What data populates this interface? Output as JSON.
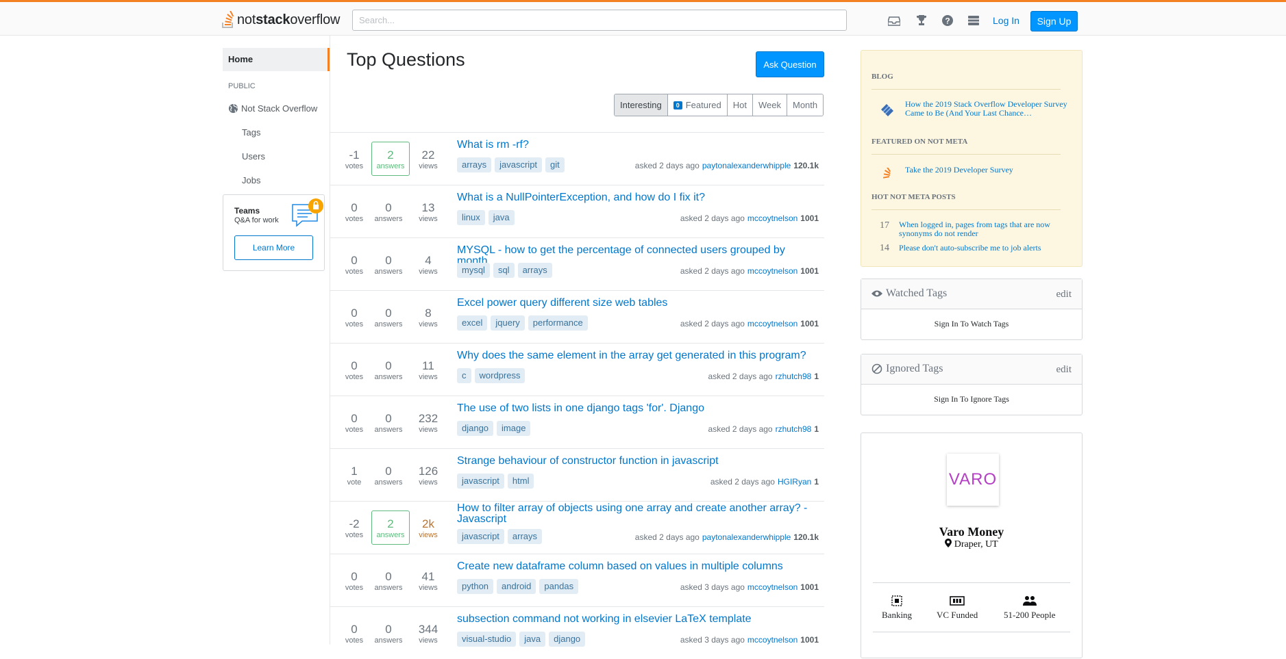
{
  "brand": {
    "name_plain": "not",
    "name_bold": "stack",
    "name_rest": "overflow",
    "accent": "#f48024"
  },
  "search": {
    "placeholder": "Search..."
  },
  "topnav": {
    "icons": [
      "inbox-icon",
      "trophy-icon",
      "help-icon",
      "site-switcher-icon"
    ],
    "login": "Log In",
    "signup": "Sign Up"
  },
  "leftnav": {
    "home": "Home",
    "public": "PUBLIC",
    "site": "Not Stack Overflow",
    "tags": "Tags",
    "users": "Users",
    "jobs": "Jobs",
    "teams": {
      "title": "Teams",
      "subtitle": "Q&A for work",
      "cta": "Learn More"
    }
  },
  "main": {
    "title": "Top Questions",
    "ask": "Ask Question",
    "filters": {
      "interesting": "Interesting",
      "featured_count": "0",
      "featured": "Featured",
      "hot": "Hot",
      "week": "Week",
      "month": "Month"
    },
    "questions": [
      {
        "votes": "-1",
        "votes_label": "votes",
        "answers": "2",
        "answers_label": "answers",
        "accepted": true,
        "views": "22",
        "views_label": "views",
        "title": "What is rm -rf?",
        "tags": [
          "arrays",
          "javascript",
          "git"
        ],
        "asked": "asked 2 days ago",
        "user": "paytonalexanderwhipple",
        "rep": "120.1k"
      },
      {
        "votes": "0",
        "votes_label": "votes",
        "answers": "0",
        "answers_label": "answers",
        "views": "13",
        "views_label": "views",
        "title": "What is a NullPointerException, and how do I fix it?",
        "tags": [
          "linux",
          "java"
        ],
        "asked": "asked 2 days ago",
        "user": "mccoytnelson",
        "rep": "1001"
      },
      {
        "votes": "0",
        "votes_label": "votes",
        "answers": "0",
        "answers_label": "answers",
        "views": "4",
        "views_label": "views",
        "title": "MYSQL - how to get the percentage of connected users grouped by month",
        "tags": [
          "mysql",
          "sql",
          "arrays"
        ],
        "asked": "asked 2 days ago",
        "user": "mccoytnelson",
        "rep": "1001"
      },
      {
        "votes": "0",
        "votes_label": "votes",
        "answers": "0",
        "answers_label": "answers",
        "views": "8",
        "views_label": "views",
        "title": "Excel power query different size web tables",
        "tags": [
          "excel",
          "jquery",
          "performance"
        ],
        "asked": "asked 2 days ago",
        "user": "mccoytnelson",
        "rep": "1001"
      },
      {
        "votes": "0",
        "votes_label": "votes",
        "answers": "0",
        "answers_label": "answers",
        "views": "11",
        "views_label": "views",
        "title": "Why does the same element in the array get generated in this program?",
        "tags": [
          "c",
          "wordpress"
        ],
        "asked": "asked 2 days ago",
        "user": "rzhutch98",
        "rep": "1"
      },
      {
        "votes": "0",
        "votes_label": "votes",
        "answers": "0",
        "answers_label": "answers",
        "views": "232",
        "views_label": "views",
        "title": "The use of two lists in one django tags 'for'. Django",
        "tags": [
          "django",
          "image"
        ],
        "asked": "asked 2 days ago",
        "user": "rzhutch98",
        "rep": "1"
      },
      {
        "votes": "1",
        "votes_label": "vote",
        "answers": "0",
        "answers_label": "answers",
        "views": "126",
        "views_label": "views",
        "title": "Strange behaviour of constructor function in javascript",
        "tags": [
          "javascript",
          "html"
        ],
        "asked": "asked 2 days ago",
        "user": "HGIRyan",
        "rep": "1"
      },
      {
        "votes": "-2",
        "votes_label": "votes",
        "answers": "2",
        "answers_label": "answers",
        "accepted": true,
        "views": "2k",
        "views_label": "views",
        "hot": true,
        "title": "How to filter array of objects using one array and create another array? - Javascript",
        "tags": [
          "javascript",
          "arrays"
        ],
        "asked": "asked 2 days ago",
        "user": "paytonalexanderwhipple",
        "rep": "120.1k"
      },
      {
        "votes": "0",
        "votes_label": "votes",
        "answers": "0",
        "answers_label": "answers",
        "views": "41",
        "views_label": "views",
        "title": "Create new dataframe column based on values in multiple columns",
        "tags": [
          "python",
          "android",
          "pandas"
        ],
        "asked": "asked 3 days ago",
        "user": "mccoytnelson",
        "rep": "1001"
      },
      {
        "votes": "0",
        "votes_label": "votes",
        "answers": "0",
        "answers_label": "answers",
        "views": "344",
        "views_label": "views",
        "title": "subsection command not working in elsevier LaTeX template",
        "tags": [
          "visual-studio",
          "java",
          "django"
        ],
        "asked": "asked 3 days ago",
        "user": "mccoytnelson",
        "rep": "1001"
      }
    ]
  },
  "sidebar": {
    "blog": {
      "heading": "BLOG",
      "post": "How the 2019 Stack Overflow Developer Survey Came to Be (And Your Last Chance…",
      "featured_heading": "FEATURED ON NOT META",
      "featured": "Take the 2019 Developer Survey",
      "hot_heading": "HOT NOT META POSTS",
      "hot": [
        {
          "count": "17",
          "title": "When logged in, pages from tags that are now synonyms do not render"
        },
        {
          "count": "14",
          "title": "Please don't auto-subscribe me to job alerts"
        }
      ]
    },
    "watched": {
      "title": "Watched Tags",
      "edit": "edit",
      "body": "Sign In To Watch Tags"
    },
    "ignored": {
      "title": "Ignored Tags",
      "edit": "edit",
      "body": "Sign In To Ignore Tags"
    },
    "company": {
      "logo_text": "VARO",
      "name": "Varo Money",
      "location": "Draper, UT",
      "perks": [
        "Banking",
        "VC Funded",
        "51-200 People"
      ]
    }
  }
}
